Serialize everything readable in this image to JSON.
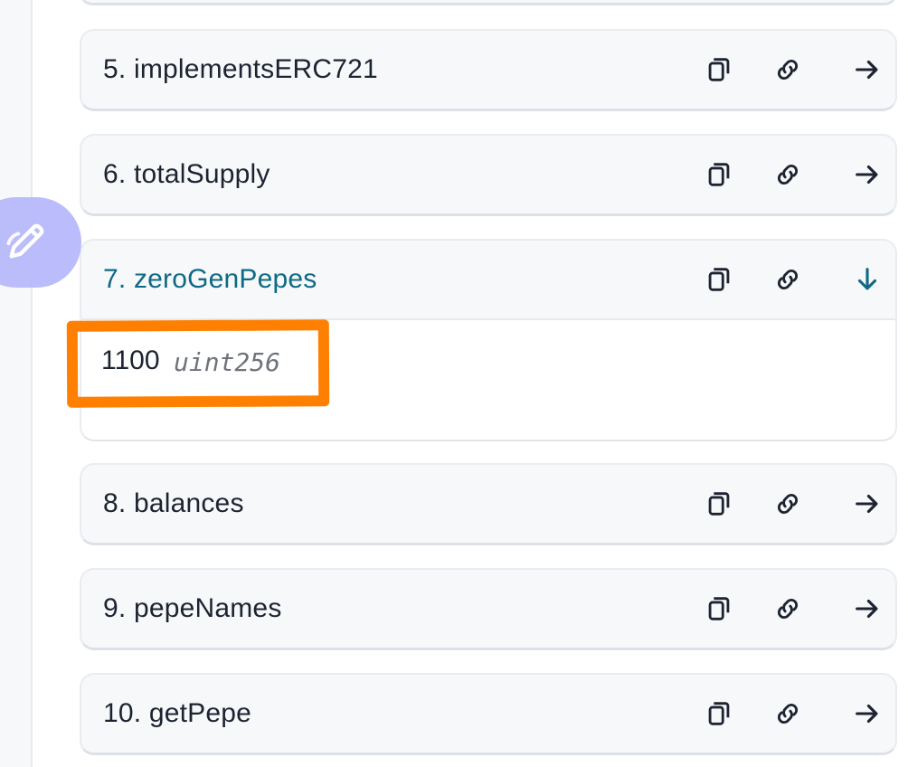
{
  "items": [
    {
      "label": "5. implementsERC721"
    },
    {
      "label": "6. totalSupply"
    },
    {
      "label": "7. zeroGenPepes"
    },
    {
      "label": "8. balances"
    },
    {
      "label": "9. pepeNames"
    },
    {
      "label": "10. getPepe"
    }
  ],
  "expanded_result": {
    "value": "1100",
    "type": "uint256"
  },
  "colors": {
    "active_label": "#0e6a85",
    "highlight": "#ff7f00",
    "fab": "#b8b9fb"
  },
  "icons": {
    "copy": "copy-icon",
    "link": "link-icon",
    "arrow_collapsed": "arrow-right-icon",
    "arrow_expanded": "arrow-down-icon",
    "fab": "pencil-icon"
  }
}
